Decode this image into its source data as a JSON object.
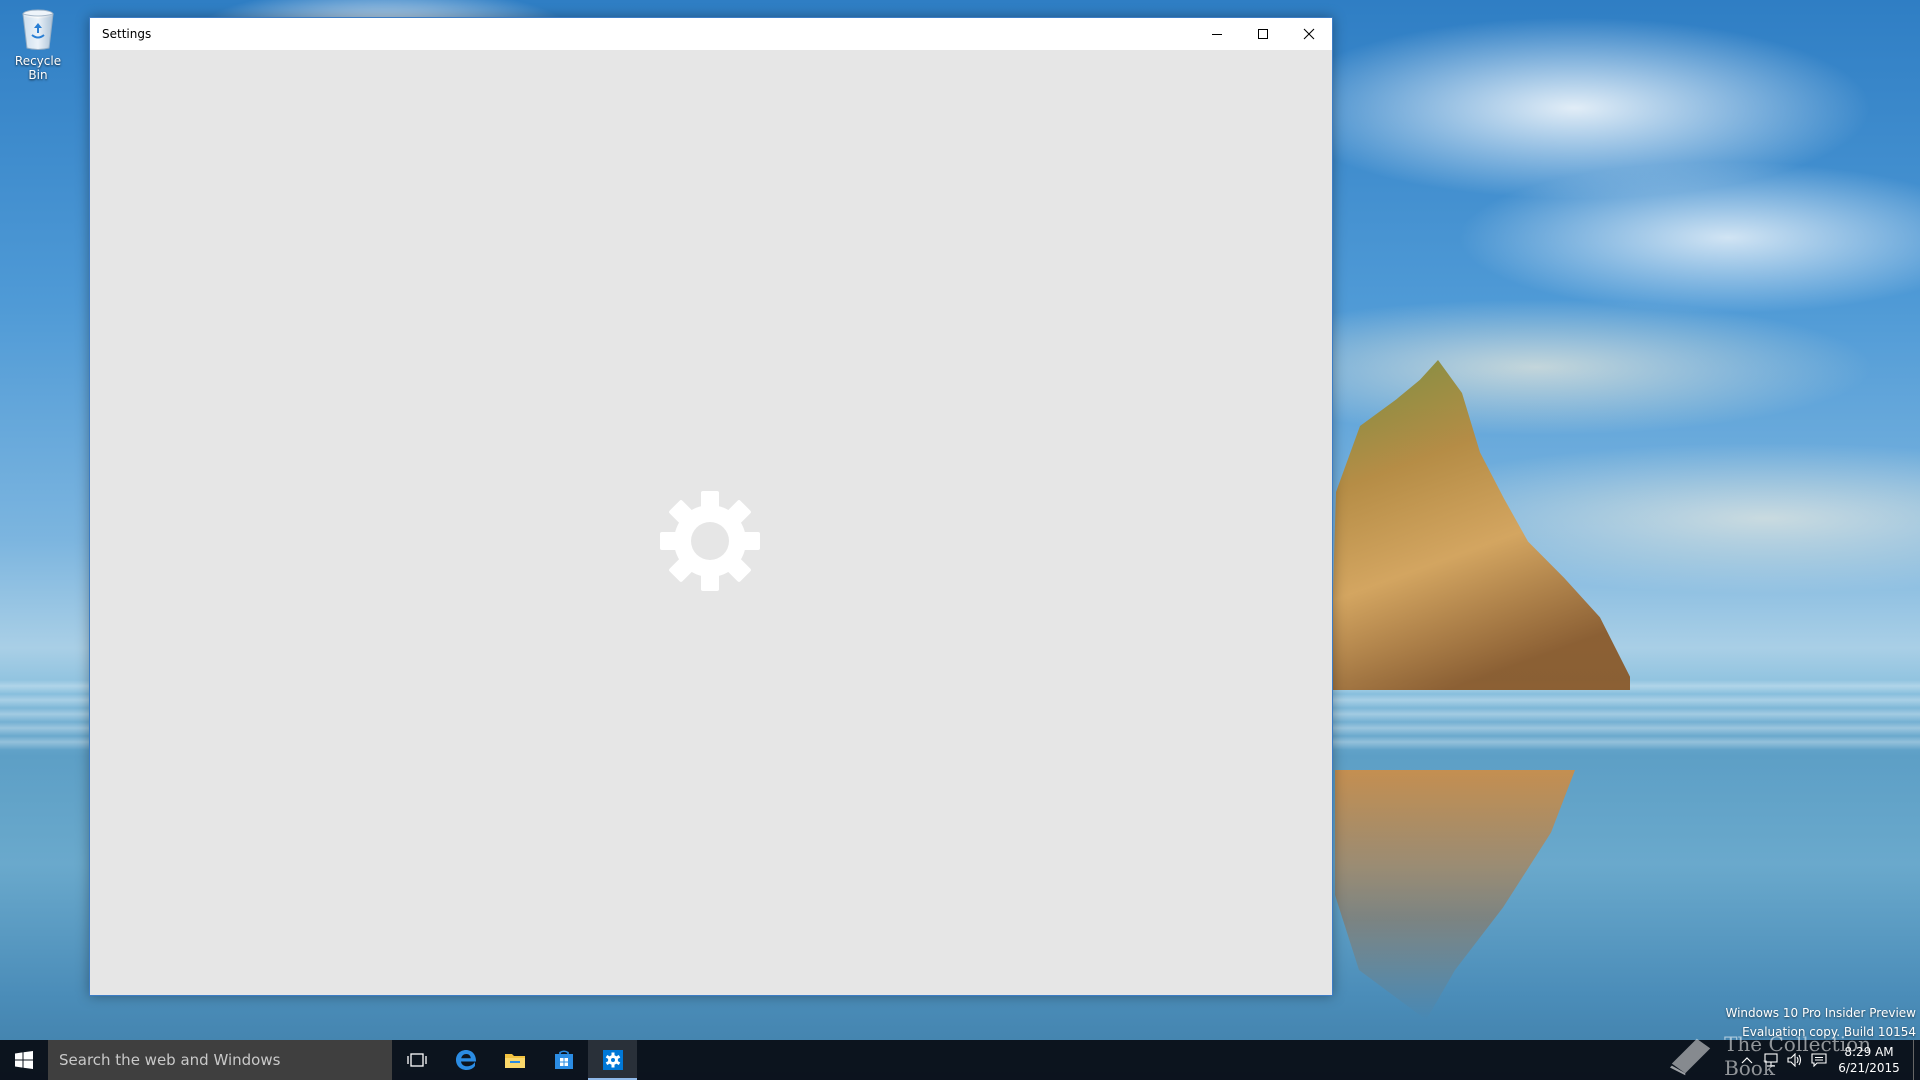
{
  "desktop": {
    "recycle_bin_label": "Recycle Bin",
    "watermark": {
      "line1": "Windows 10 Pro Insider Preview",
      "line2": "Evaluation copy. Build 10154"
    },
    "brand_watermark": "The Collection Book"
  },
  "window": {
    "title": "Settings",
    "background": "#e6e6e6",
    "loading_icon": "gear-icon",
    "buttons": {
      "minimize_icon": "minimize-icon",
      "maximize_icon": "maximize-icon",
      "close_icon": "close-icon"
    }
  },
  "taskbar": {
    "search_placeholder": "Search the web and Windows",
    "pinned": [
      {
        "name": "task-view",
        "icon": "task-view-icon"
      },
      {
        "name": "edge",
        "icon": "edge-icon"
      },
      {
        "name": "file-explorer",
        "icon": "folder-icon"
      },
      {
        "name": "store",
        "icon": "store-icon"
      },
      {
        "name": "settings",
        "icon": "gear-icon",
        "active": true
      }
    ],
    "clock": {
      "time": "8:29 AM",
      "date": "6/21/2015"
    },
    "accent": "#0078d7"
  }
}
